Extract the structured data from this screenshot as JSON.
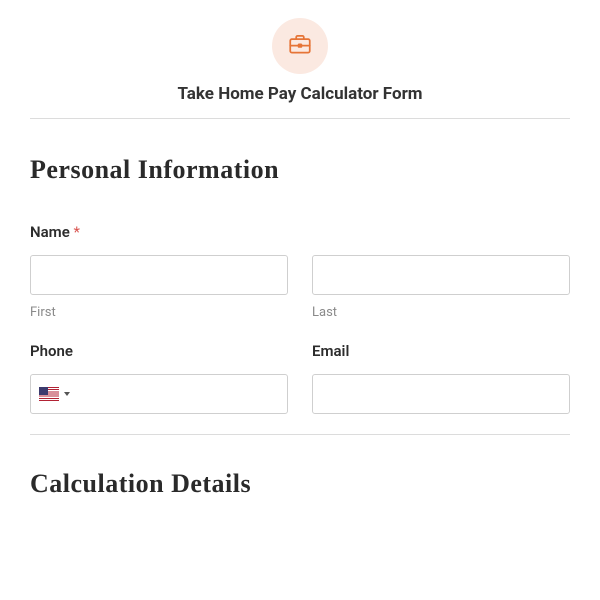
{
  "header": {
    "icon": "briefcase-icon",
    "title": "Take Home Pay Calculator Form"
  },
  "sections": {
    "personal": {
      "title": "Personal Information",
      "name": {
        "label": "Name",
        "required_marker": "*",
        "first_sub": "First",
        "last_sub": "Last",
        "first_value": "",
        "last_value": ""
      },
      "phone": {
        "label": "Phone",
        "value": "",
        "country": "US"
      },
      "email": {
        "label": "Email",
        "value": ""
      }
    },
    "calculation": {
      "title": "Calculation Details"
    }
  },
  "colors": {
    "accent": "#e67436",
    "icon_bg": "#fbe9e1",
    "border": "#cfcfcf",
    "required": "#d9534f"
  }
}
